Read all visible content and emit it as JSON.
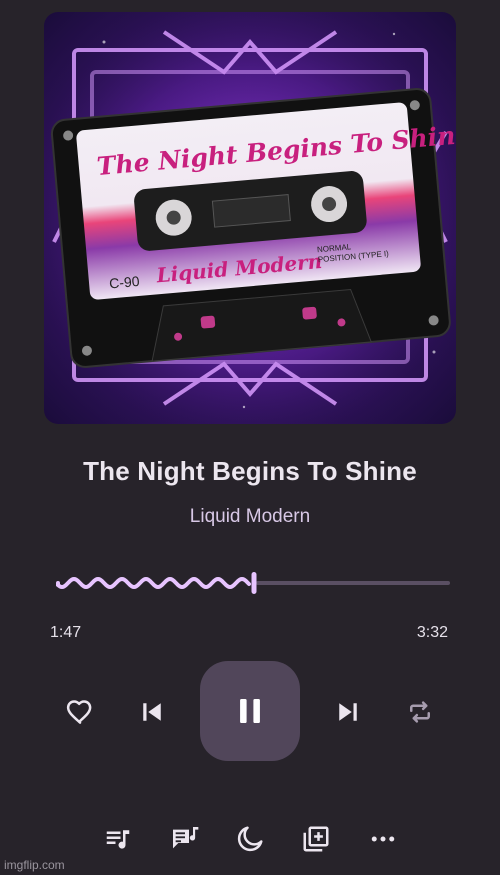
{
  "track": {
    "title": "The Night Begins To Shine",
    "artist": "Liquid Modern"
  },
  "album_art": {
    "cassette_title": "The Night Begins To Shine",
    "cassette_artist": "Liquid Modern",
    "tape_length": "C-90",
    "tape_position_line1": "NORMAL",
    "tape_position_line2": "POSITION (TYPE I)"
  },
  "progress": {
    "elapsed": "1:47",
    "total": "3:32",
    "fraction": 0.505
  },
  "controls": {
    "favorite_icon": "heart-outline-icon",
    "previous_icon": "skip-previous-icon",
    "playpause_icon": "pause-icon",
    "next_icon": "skip-next-icon",
    "repeat_icon": "repeat-icon"
  },
  "bottom_bar": {
    "icons": [
      "queue-music-icon",
      "lyrics-icon",
      "sleep-timer-icon",
      "add-to-playlist-icon",
      "more-options-icon"
    ]
  },
  "colors": {
    "background": "#27232a",
    "accent": "#e7c4ff",
    "track_inactive": "#5a4f63",
    "button_bg": "#51465a"
  },
  "watermark": "imgflip.com"
}
